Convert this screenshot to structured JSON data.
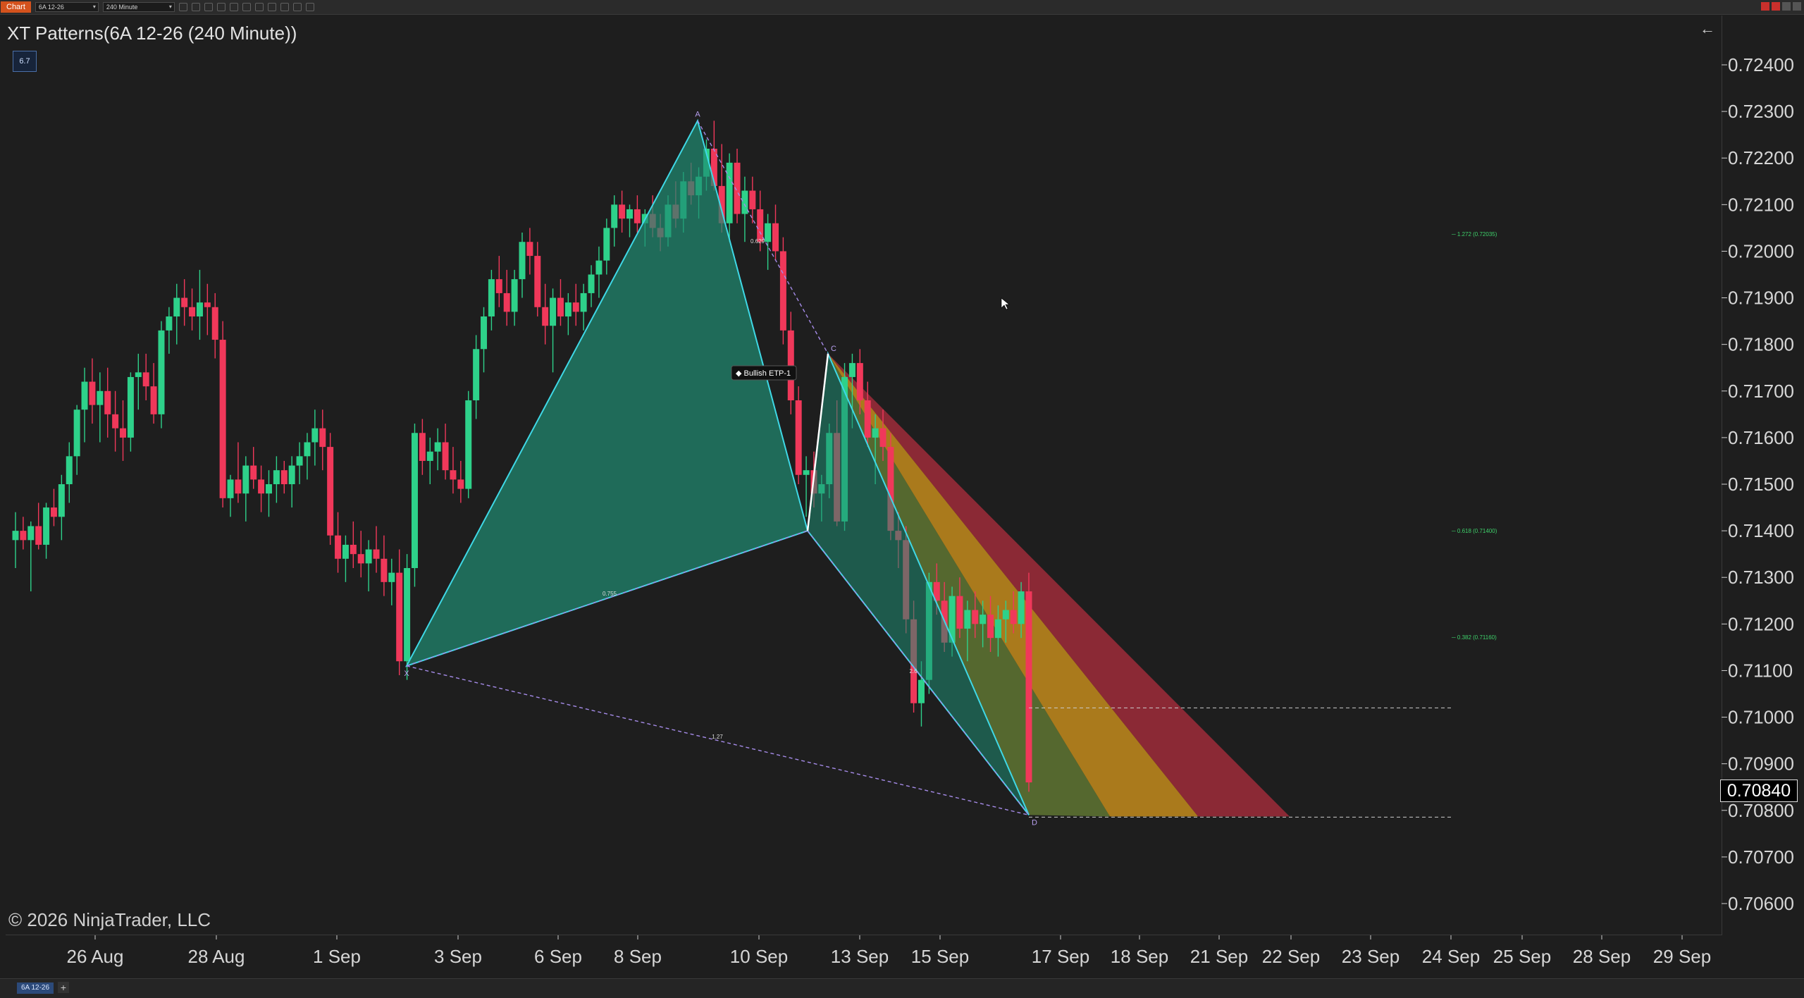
{
  "toolbar": {
    "chart_label": "Chart",
    "instrument": "6A 12-26",
    "interval": "240 Minute"
  },
  "chart": {
    "title": "XT Patterns(6A 12-26 (240 Minute))",
    "badge": "6.7",
    "copyright": "© 2026 NinjaTrader, LLC",
    "current_price": "0.70840",
    "pattern_label": "Bullish ETP-1",
    "instrument_tab": "6A 12-26",
    "add_tab": "+"
  },
  "colors": {
    "background": "#1e1e1e",
    "up_candle": "#2ed18a",
    "down_candle": "#f0385a",
    "pattern_fill": "#1f8c72",
    "pattern_line": "#3fd8e6",
    "fib_line": "#a58be8",
    "zone_red": "#b02e3e",
    "zone_orange": "#d99a1c"
  },
  "chart_data": {
    "type": "candlestick",
    "title": "XT Patterns(6A 12-26 (240 Minute))",
    "y_axis": {
      "ticks": [
        "0.72400",
        "0.72300",
        "0.72200",
        "0.72100",
        "0.72000",
        "0.71900",
        "0.71800",
        "0.71700",
        "0.71600",
        "0.71500",
        "0.71400",
        "0.71300",
        "0.71200",
        "0.71100",
        "0.71000",
        "0.70900",
        "0.70800",
        "0.70700",
        "0.70600"
      ],
      "range": [
        0.7055,
        0.7245
      ]
    },
    "x_axis": {
      "ticks": [
        "26 Aug",
        "28 Aug",
        "1 Sep",
        "3 Sep",
        "6 Sep",
        "8 Sep",
        "10 Sep",
        "13 Sep",
        "15 Sep",
        "17 Sep",
        "18 Sep",
        "21 Sep",
        "22 Sep",
        "23 Sep",
        "24 Sep",
        "25 Sep",
        "28 Sep",
        "29 Sep"
      ]
    },
    "pattern": {
      "name": "Bullish ETP-1",
      "points": {
        "X": 0.7111,
        "A": 0.7228,
        "B": 0.714,
        "C": 0.7178,
        "D": 0.7079
      },
      "ratios": [
        "0.755",
        "0.629",
        "1.27",
        "2.6"
      ],
      "fib_levels": [
        "1.272 (0.72035)",
        "0.618 (0.71400)",
        "0.382 (0.71160)"
      ]
    },
    "candles": [
      {
        "o": 0.7138,
        "h": 0.7144,
        "l": 0.7132,
        "c": 0.714
      },
      {
        "o": 0.714,
        "h": 0.7143,
        "l": 0.7136,
        "c": 0.7138
      },
      {
        "o": 0.7138,
        "h": 0.7142,
        "l": 0.7127,
        "c": 0.7141
      },
      {
        "o": 0.7141,
        "h": 0.7146,
        "l": 0.7136,
        "c": 0.7137
      },
      {
        "o": 0.7137,
        "h": 0.7146,
        "l": 0.7134,
        "c": 0.7145
      },
      {
        "o": 0.7145,
        "h": 0.7149,
        "l": 0.7141,
        "c": 0.7143
      },
      {
        "o": 0.7143,
        "h": 0.7152,
        "l": 0.7138,
        "c": 0.715
      },
      {
        "o": 0.715,
        "h": 0.7159,
        "l": 0.7146,
        "c": 0.7156
      },
      {
        "o": 0.7156,
        "h": 0.7167,
        "l": 0.7152,
        "c": 0.7166
      },
      {
        "o": 0.7166,
        "h": 0.7175,
        "l": 0.7159,
        "c": 0.7172
      },
      {
        "o": 0.7172,
        "h": 0.7177,
        "l": 0.7163,
        "c": 0.7167
      },
      {
        "o": 0.7167,
        "h": 0.7174,
        "l": 0.7159,
        "c": 0.717
      },
      {
        "o": 0.717,
        "h": 0.7175,
        "l": 0.716,
        "c": 0.7165
      },
      {
        "o": 0.7165,
        "h": 0.717,
        "l": 0.7157,
        "c": 0.7162
      },
      {
        "o": 0.7162,
        "h": 0.7168,
        "l": 0.7155,
        "c": 0.716
      },
      {
        "o": 0.716,
        "h": 0.7174,
        "l": 0.7157,
        "c": 0.7173
      },
      {
        "o": 0.7173,
        "h": 0.7178,
        "l": 0.7166,
        "c": 0.7174
      },
      {
        "o": 0.7174,
        "h": 0.7178,
        "l": 0.7168,
        "c": 0.7171
      },
      {
        "o": 0.7171,
        "h": 0.7176,
        "l": 0.7163,
        "c": 0.7165
      },
      {
        "o": 0.7165,
        "h": 0.7185,
        "l": 0.7162,
        "c": 0.7183
      },
      {
        "o": 0.7183,
        "h": 0.7188,
        "l": 0.7178,
        "c": 0.7186
      },
      {
        "o": 0.7186,
        "h": 0.7193,
        "l": 0.718,
        "c": 0.719
      },
      {
        "o": 0.719,
        "h": 0.7194,
        "l": 0.7184,
        "c": 0.7188
      },
      {
        "o": 0.7188,
        "h": 0.7192,
        "l": 0.7183,
        "c": 0.7186
      },
      {
        "o": 0.7186,
        "h": 0.7196,
        "l": 0.7181,
        "c": 0.7189
      },
      {
        "o": 0.7189,
        "h": 0.7193,
        "l": 0.7182,
        "c": 0.7188
      },
      {
        "o": 0.7188,
        "h": 0.7191,
        "l": 0.7177,
        "c": 0.7181
      },
      {
        "o": 0.7181,
        "h": 0.7185,
        "l": 0.7145,
        "c": 0.7147
      },
      {
        "o": 0.7147,
        "h": 0.7152,
        "l": 0.7143,
        "c": 0.7151
      },
      {
        "o": 0.7151,
        "h": 0.7159,
        "l": 0.7146,
        "c": 0.7148
      },
      {
        "o": 0.7148,
        "h": 0.7156,
        "l": 0.7142,
        "c": 0.7154
      },
      {
        "o": 0.7154,
        "h": 0.7158,
        "l": 0.7149,
        "c": 0.7151
      },
      {
        "o": 0.7151,
        "h": 0.7154,
        "l": 0.7144,
        "c": 0.7148
      },
      {
        "o": 0.7148,
        "h": 0.7153,
        "l": 0.7143,
        "c": 0.715
      },
      {
        "o": 0.715,
        "h": 0.7156,
        "l": 0.7146,
        "c": 0.7153
      },
      {
        "o": 0.7153,
        "h": 0.7155,
        "l": 0.7148,
        "c": 0.715
      },
      {
        "o": 0.715,
        "h": 0.7156,
        "l": 0.7145,
        "c": 0.7154
      },
      {
        "o": 0.7154,
        "h": 0.7159,
        "l": 0.715,
        "c": 0.7156
      },
      {
        "o": 0.7156,
        "h": 0.7161,
        "l": 0.7151,
        "c": 0.7159
      },
      {
        "o": 0.7159,
        "h": 0.7166,
        "l": 0.7154,
        "c": 0.7162
      },
      {
        "o": 0.7162,
        "h": 0.7166,
        "l": 0.7153,
        "c": 0.7158
      },
      {
        "o": 0.7158,
        "h": 0.7161,
        "l": 0.7137,
        "c": 0.7139
      },
      {
        "o": 0.7139,
        "h": 0.7144,
        "l": 0.7131,
        "c": 0.7134
      },
      {
        "o": 0.7134,
        "h": 0.7139,
        "l": 0.7129,
        "c": 0.7137
      },
      {
        "o": 0.7137,
        "h": 0.7142,
        "l": 0.7132,
        "c": 0.7135
      },
      {
        "o": 0.7135,
        "h": 0.714,
        "l": 0.713,
        "c": 0.7133
      },
      {
        "o": 0.7133,
        "h": 0.7138,
        "l": 0.7127,
        "c": 0.7136
      },
      {
        "o": 0.7136,
        "h": 0.7141,
        "l": 0.7131,
        "c": 0.7134
      },
      {
        "o": 0.7134,
        "h": 0.7139,
        "l": 0.7126,
        "c": 0.7129
      },
      {
        "o": 0.7129,
        "h": 0.7134,
        "l": 0.7124,
        "c": 0.7131
      },
      {
        "o": 0.7131,
        "h": 0.7136,
        "l": 0.7109,
        "c": 0.7112
      },
      {
        "o": 0.7112,
        "h": 0.7135,
        "l": 0.7108,
        "c": 0.7132
      },
      {
        "o": 0.7132,
        "h": 0.7163,
        "l": 0.7128,
        "c": 0.7161
      },
      {
        "o": 0.7161,
        "h": 0.7164,
        "l": 0.7152,
        "c": 0.7155
      },
      {
        "o": 0.7155,
        "h": 0.716,
        "l": 0.715,
        "c": 0.7157
      },
      {
        "o": 0.7157,
        "h": 0.7162,
        "l": 0.7153,
        "c": 0.7159
      },
      {
        "o": 0.7159,
        "h": 0.7163,
        "l": 0.7151,
        "c": 0.7153
      },
      {
        "o": 0.7153,
        "h": 0.7158,
        "l": 0.7148,
        "c": 0.7151
      },
      {
        "o": 0.7151,
        "h": 0.7155,
        "l": 0.7146,
        "c": 0.7149
      },
      {
        "o": 0.7149,
        "h": 0.717,
        "l": 0.7147,
        "c": 0.7168
      },
      {
        "o": 0.7168,
        "h": 0.7182,
        "l": 0.7164,
        "c": 0.7179
      },
      {
        "o": 0.7179,
        "h": 0.7188,
        "l": 0.7174,
        "c": 0.7186
      },
      {
        "o": 0.7186,
        "h": 0.7196,
        "l": 0.7183,
        "c": 0.7194
      },
      {
        "o": 0.7194,
        "h": 0.7199,
        "l": 0.7188,
        "c": 0.7191
      },
      {
        "o": 0.7191,
        "h": 0.7196,
        "l": 0.7184,
        "c": 0.7187
      },
      {
        "o": 0.7187,
        "h": 0.7196,
        "l": 0.7184,
        "c": 0.7194
      },
      {
        "o": 0.7194,
        "h": 0.7204,
        "l": 0.719,
        "c": 0.7202
      },
      {
        "o": 0.7202,
        "h": 0.7205,
        "l": 0.7195,
        "c": 0.7199
      },
      {
        "o": 0.7199,
        "h": 0.7202,
        "l": 0.7186,
        "c": 0.7188
      },
      {
        "o": 0.7188,
        "h": 0.7193,
        "l": 0.718,
        "c": 0.7184
      },
      {
        "o": 0.7184,
        "h": 0.7192,
        "l": 0.7174,
        "c": 0.719
      },
      {
        "o": 0.719,
        "h": 0.7194,
        "l": 0.7184,
        "c": 0.7186
      },
      {
        "o": 0.7186,
        "h": 0.7191,
        "l": 0.7182,
        "c": 0.7189
      },
      {
        "o": 0.7189,
        "h": 0.7193,
        "l": 0.7184,
        "c": 0.7187
      },
      {
        "o": 0.7187,
        "h": 0.7193,
        "l": 0.7183,
        "c": 0.7191
      },
      {
        "o": 0.7191,
        "h": 0.7197,
        "l": 0.7188,
        "c": 0.7195
      },
      {
        "o": 0.7195,
        "h": 0.7201,
        "l": 0.719,
        "c": 0.7198
      },
      {
        "o": 0.7198,
        "h": 0.7207,
        "l": 0.7195,
        "c": 0.7205
      },
      {
        "o": 0.7205,
        "h": 0.7212,
        "l": 0.7201,
        "c": 0.721
      },
      {
        "o": 0.721,
        "h": 0.7213,
        "l": 0.7204,
        "c": 0.7207
      },
      {
        "o": 0.7207,
        "h": 0.721,
        "l": 0.7203,
        "c": 0.7209
      },
      {
        "o": 0.7209,
        "h": 0.7212,
        "l": 0.7204,
        "c": 0.7206
      },
      {
        "o": 0.7206,
        "h": 0.7209,
        "l": 0.7201,
        "c": 0.7208
      },
      {
        "o": 0.7208,
        "h": 0.7212,
        "l": 0.7203,
        "c": 0.7205
      },
      {
        "o": 0.7205,
        "h": 0.7208,
        "l": 0.72,
        "c": 0.7203
      },
      {
        "o": 0.7203,
        "h": 0.7212,
        "l": 0.7201,
        "c": 0.721
      },
      {
        "o": 0.721,
        "h": 0.7215,
        "l": 0.7205,
        "c": 0.7207
      },
      {
        "o": 0.7207,
        "h": 0.7217,
        "l": 0.7204,
        "c": 0.7215
      },
      {
        "o": 0.7215,
        "h": 0.7219,
        "l": 0.721,
        "c": 0.7212
      },
      {
        "o": 0.7212,
        "h": 0.7218,
        "l": 0.7207,
        "c": 0.7216
      },
      {
        "o": 0.7216,
        "h": 0.7224,
        "l": 0.7213,
        "c": 0.7222
      },
      {
        "o": 0.7222,
        "h": 0.7228,
        "l": 0.7213,
        "c": 0.7214
      },
      {
        "o": 0.7214,
        "h": 0.7223,
        "l": 0.7204,
        "c": 0.7206
      },
      {
        "o": 0.7206,
        "h": 0.7221,
        "l": 0.7202,
        "c": 0.7219
      },
      {
        "o": 0.7219,
        "h": 0.7222,
        "l": 0.7206,
        "c": 0.7208
      },
      {
        "o": 0.7208,
        "h": 0.7216,
        "l": 0.7202,
        "c": 0.7213
      },
      {
        "o": 0.7213,
        "h": 0.7216,
        "l": 0.7206,
        "c": 0.7209
      },
      {
        "o": 0.7209,
        "h": 0.7213,
        "l": 0.72,
        "c": 0.7202
      },
      {
        "o": 0.7202,
        "h": 0.7208,
        "l": 0.7196,
        "c": 0.7206
      },
      {
        "o": 0.7206,
        "h": 0.721,
        "l": 0.7198,
        "c": 0.72
      },
      {
        "o": 0.72,
        "h": 0.7203,
        "l": 0.718,
        "c": 0.7183
      },
      {
        "o": 0.7183,
        "h": 0.7187,
        "l": 0.7165,
        "c": 0.7168
      },
      {
        "o": 0.7168,
        "h": 0.7171,
        "l": 0.715,
        "c": 0.7152
      },
      {
        "o": 0.7152,
        "h": 0.7156,
        "l": 0.7143,
        "c": 0.7153
      },
      {
        "o": 0.7153,
        "h": 0.7157,
        "l": 0.7145,
        "c": 0.7148
      },
      {
        "o": 0.7148,
        "h": 0.7152,
        "l": 0.7142,
        "c": 0.715
      },
      {
        "o": 0.715,
        "h": 0.7163,
        "l": 0.7147,
        "c": 0.7161
      },
      {
        "o": 0.7161,
        "h": 0.7168,
        "l": 0.7141,
        "c": 0.7142
      },
      {
        "o": 0.7142,
        "h": 0.7176,
        "l": 0.714,
        "c": 0.7173
      },
      {
        "o": 0.7173,
        "h": 0.7178,
        "l": 0.7162,
        "c": 0.7176
      },
      {
        "o": 0.7176,
        "h": 0.7179,
        "l": 0.7165,
        "c": 0.7168
      },
      {
        "o": 0.7168,
        "h": 0.7172,
        "l": 0.7158,
        "c": 0.716
      },
      {
        "o": 0.716,
        "h": 0.7165,
        "l": 0.715,
        "c": 0.7162
      },
      {
        "o": 0.7162,
        "h": 0.7166,
        "l": 0.7155,
        "c": 0.7158
      },
      {
        "o": 0.7158,
        "h": 0.7161,
        "l": 0.7138,
        "c": 0.714
      },
      {
        "o": 0.714,
        "h": 0.7144,
        "l": 0.7132,
        "c": 0.7138
      },
      {
        "o": 0.7138,
        "h": 0.7141,
        "l": 0.7118,
        "c": 0.7121
      },
      {
        "o": 0.7121,
        "h": 0.7125,
        "l": 0.7101,
        "c": 0.7103
      },
      {
        "o": 0.7103,
        "h": 0.7112,
        "l": 0.7098,
        "c": 0.7108
      },
      {
        "o": 0.7108,
        "h": 0.7131,
        "l": 0.7105,
        "c": 0.7129
      },
      {
        "o": 0.7129,
        "h": 0.7133,
        "l": 0.7122,
        "c": 0.7125
      },
      {
        "o": 0.7125,
        "h": 0.7129,
        "l": 0.7114,
        "c": 0.7116
      },
      {
        "o": 0.7116,
        "h": 0.7128,
        "l": 0.7113,
        "c": 0.7126
      },
      {
        "o": 0.7126,
        "h": 0.713,
        "l": 0.7117,
        "c": 0.7119
      },
      {
        "o": 0.7119,
        "h": 0.7125,
        "l": 0.7112,
        "c": 0.7123
      },
      {
        "o": 0.7123,
        "h": 0.7127,
        "l": 0.7117,
        "c": 0.712
      },
      {
        "o": 0.712,
        "h": 0.7125,
        "l": 0.7115,
        "c": 0.7122
      },
      {
        "o": 0.7122,
        "h": 0.7126,
        "l": 0.7114,
        "c": 0.7117
      },
      {
        "o": 0.7117,
        "h": 0.7124,
        "l": 0.7113,
        "c": 0.7121
      },
      {
        "o": 0.7121,
        "h": 0.7125,
        "l": 0.7116,
        "c": 0.7123
      },
      {
        "o": 0.7123,
        "h": 0.7127,
        "l": 0.7118,
        "c": 0.712
      },
      {
        "o": 0.712,
        "h": 0.7129,
        "l": 0.7117,
        "c": 0.7127
      },
      {
        "o": 0.7127,
        "h": 0.7131,
        "l": 0.7084,
        "c": 0.7086
      }
    ]
  }
}
